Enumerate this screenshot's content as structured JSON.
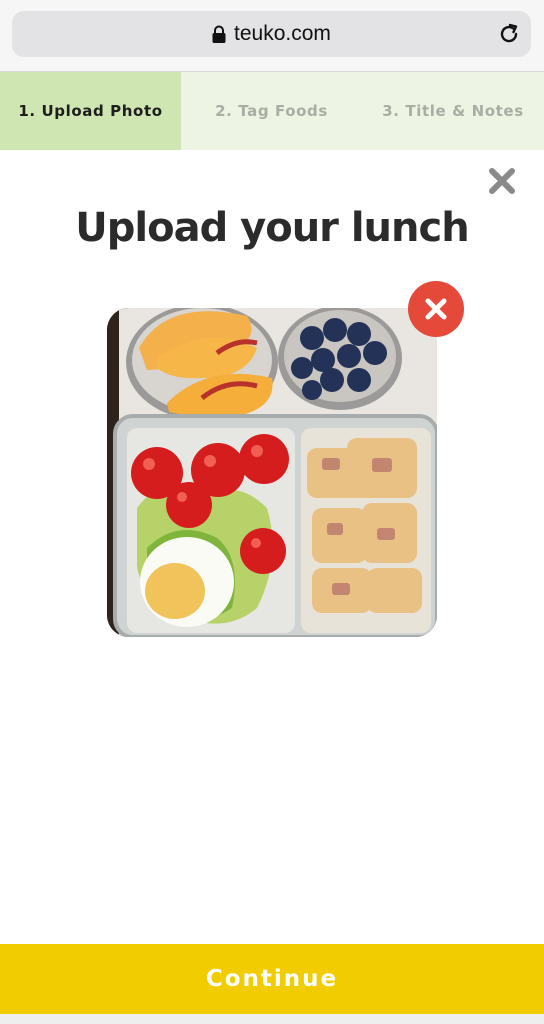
{
  "browser": {
    "url": "teuko.com",
    "lock_icon": "lock-icon",
    "reload_icon": "reload-icon"
  },
  "steps": [
    {
      "label": "1. Upload Photo",
      "active": true
    },
    {
      "label": "2. Tag Foods",
      "active": false
    },
    {
      "label": "3. Title & Notes",
      "active": false
    }
  ],
  "modal": {
    "close_icon": "close-icon",
    "title": "Upload your lunch",
    "photo_icon": "lunch-photo",
    "remove_photo_icon": "remove-photo-icon"
  },
  "actions": {
    "continue_label": "Continue"
  },
  "colors": {
    "active_step": "#cfe6b3",
    "inactive_step": "#eef4e3",
    "continue_button": "#f0cc00",
    "remove_button": "#e4493a"
  }
}
